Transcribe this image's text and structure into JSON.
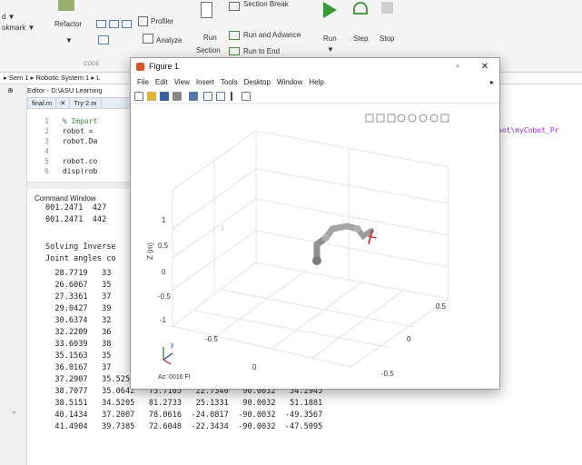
{
  "ribbon": {
    "cut_left_top": "d ▼",
    "cut_left_mid": "okmark ▼",
    "refactor": "Refactor",
    "profiler": "Profiler",
    "analyze": "Analyze",
    "run_section": "Run\nSection",
    "section_break": "Section Break",
    "run_and_advance": "Run and Advance",
    "run_to_end": "Run to End",
    "run": "Run",
    "step": "Step",
    "stop": "Stop",
    "group_code": "CODE"
  },
  "path": "▸ Sem 1 ▸ Robotic System 1 ▸ L",
  "editor": {
    "title": "Editor - D:\\ASU Learning",
    "tabs": [
      "final.m",
      "Try 2.m"
    ],
    "lines": [
      {
        "n": "1",
        "code": "  % Import"
      },
      {
        "n": "2",
        "code": "  robot = "
      },
      {
        "n": "3",
        "code": "  robot.Da"
      },
      {
        "n": "4",
        "code": ""
      },
      {
        "n": "5",
        "code": "  robot.co"
      },
      {
        "n": "6",
        "code": "  disp(rob"
      }
    ],
    "right_fragment": "bot\\myCobot_Pr"
  },
  "command_window": {
    "title": "Command Window",
    "lines": [
      "001.2471  427",
      "001.2471  442",
      "",
      "Solving Inverse",
      "Joint angles co",
      "  28.7719   33",
      "  26.6067   35",
      "  27.3361   37",
      "  29.0427   39",
      "  30.6374   32",
      "  32.2209   36",
      "  33.6039   38",
      "  35.1563   35",
      "  36.0167   37",
      "  37.2907   35.5259   79.5843   23.7354   90.0032   55.7101",
      "  38.7077   35.0642   73.7105   22.7340   90.0032   54.2945",
      "  38.5151   34.5205   81.2733   25.1331   90.0032   51.1881",
      "  40.1434   37.2007   78.0616  -24.0817  -90.0032  -49.3567",
      "  41.4904   39.7385   72.6048  -22.3434  -90.0032  -47.5095"
    ]
  },
  "figure": {
    "title": "Figure 1",
    "minimize": "▫",
    "close": "✕",
    "menus": [
      "File",
      "Edit",
      "View",
      "Insert",
      "Tools",
      "Desktop",
      "Window",
      "Help"
    ],
    "menu_more": "▸",
    "az_label": "Az: 0016  Fl",
    "z_axis_label": "Z (m)",
    "z_ticks": [
      "1",
      "0.5",
      "0",
      "-0.5",
      "-1"
    ],
    "x_ticks": [
      "-0.5",
      "0"
    ],
    "y_ticks": [
      "0.5",
      "0",
      "-0.5"
    ],
    "triad_y": "y"
  }
}
